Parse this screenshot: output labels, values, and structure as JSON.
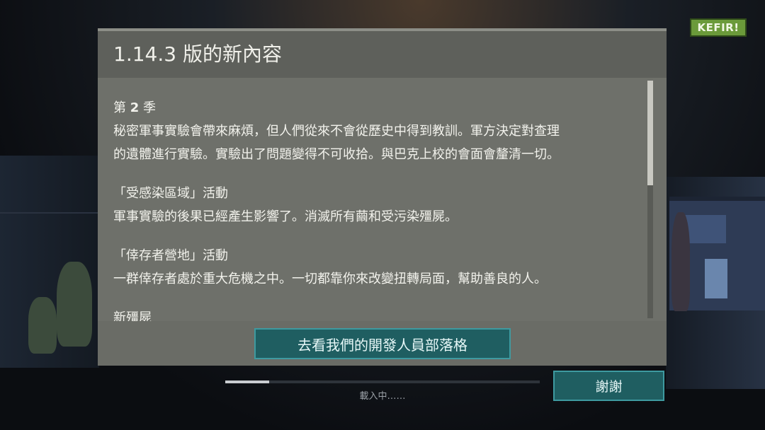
{
  "logo": {
    "text": "KEFIR!"
  },
  "dialog": {
    "title": "1.14.3 版的新內容",
    "sections": [
      {
        "heading_prefix": "第 ",
        "heading_num": "2",
        "heading_suffix": " 季",
        "lines": [
          "秘密軍事實驗會帶來麻煩，但人們從來不會從歷史中得到教訓。軍方決定對查理",
          "的遺體進行實驗。實驗出了問題變得不可收拾。與巴克上校的會面會釐清一切。"
        ]
      },
      {
        "heading": "「受感染區域」活動",
        "lines": [
          "軍事實驗的後果已經產生影響了。消滅所有繭和受污染殭屍。"
        ]
      },
      {
        "heading": "「倖存者營地」活動",
        "lines": [
          "一群倖存者處於重大危機之中。一切都靠你來改變扭轉局面，幫助善良的人。"
        ]
      },
      {
        "heading": "新殭屍",
        "lines": []
      }
    ],
    "scroll_position": 0.0,
    "dev_blog_button": "去看我們的開發人員部落格"
  },
  "loading": {
    "progress": 0.14,
    "text": "載入中……"
  },
  "thanks_button": "謝謝"
}
